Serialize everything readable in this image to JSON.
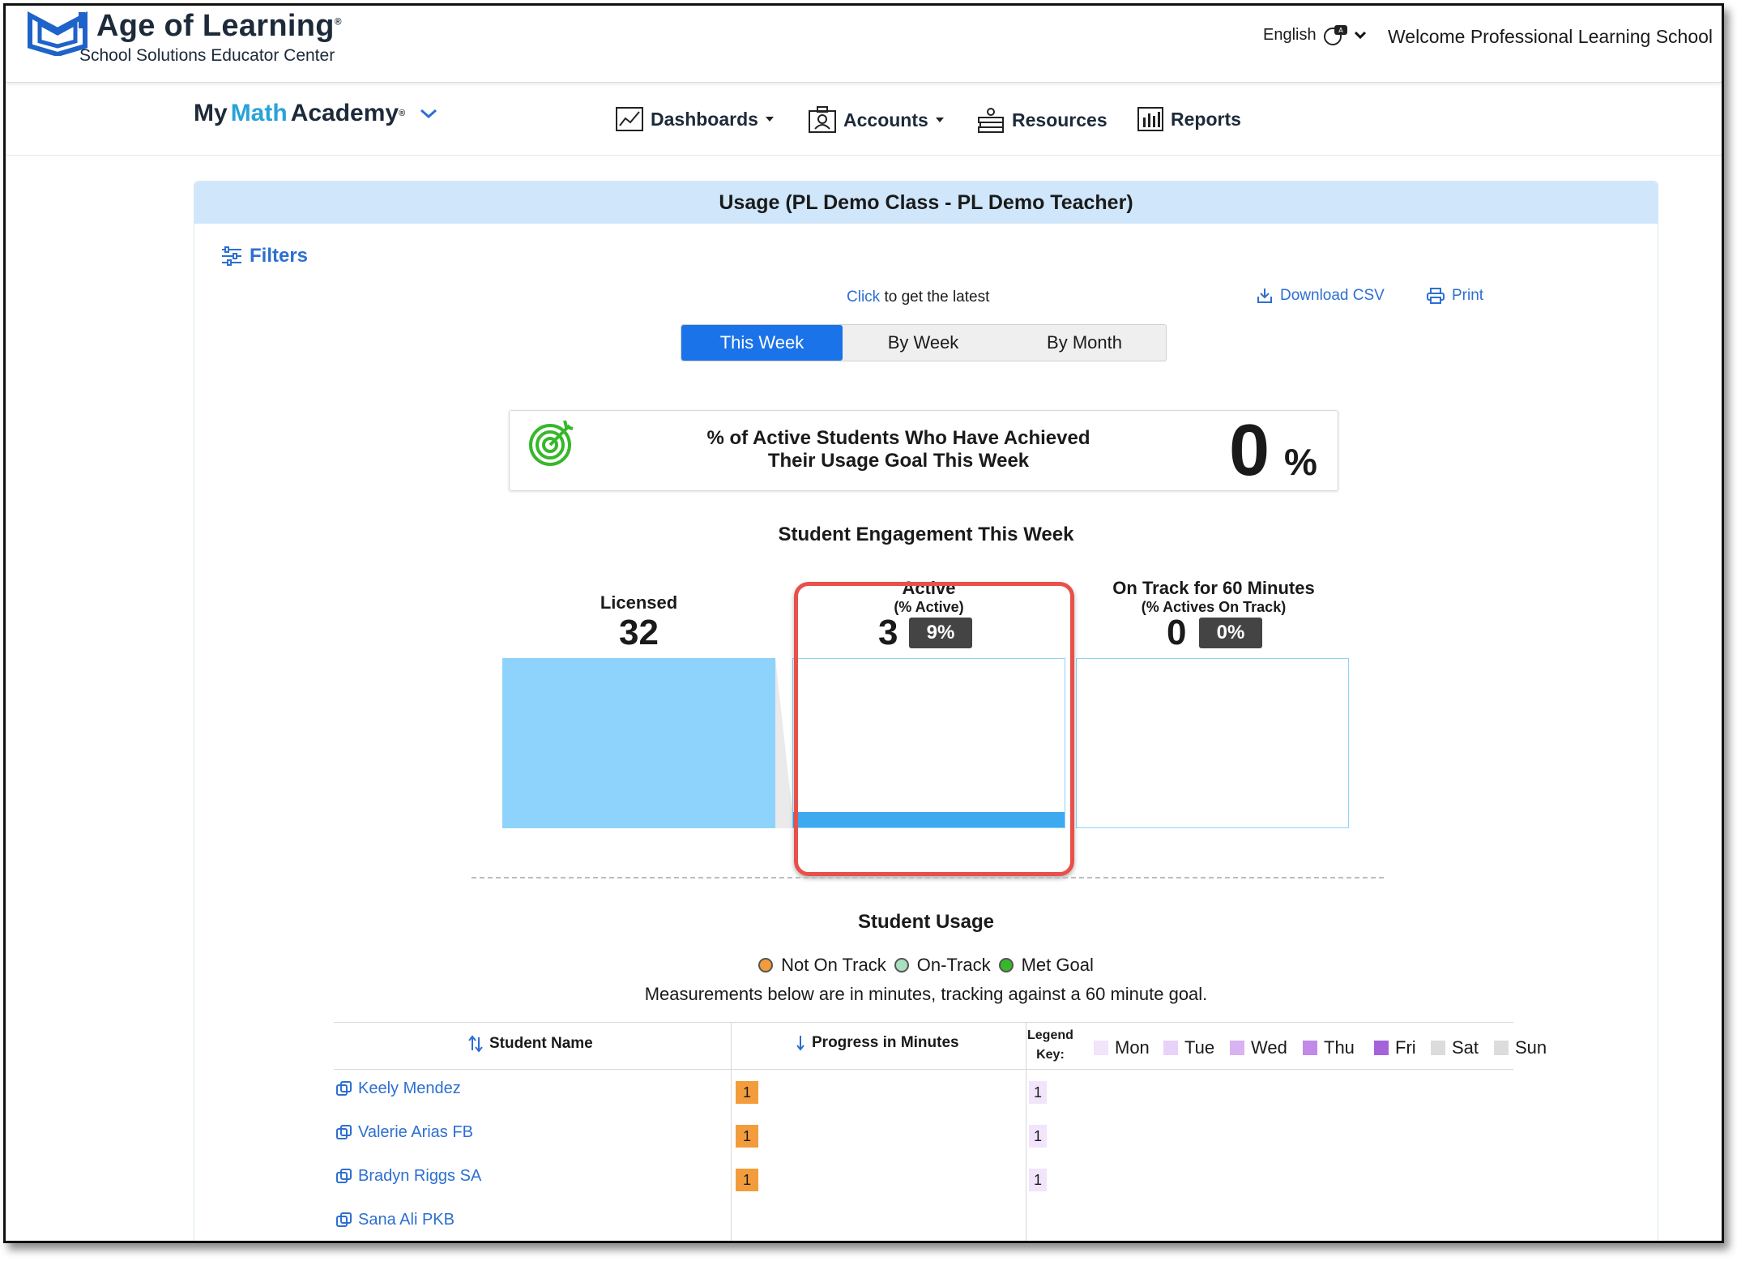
{
  "header": {
    "brand_title": "Age of Learning",
    "brand_registered": "®",
    "brand_subtitle": "School Solutions Educator Center",
    "language": "English",
    "welcome": "Welcome Professional Learning School"
  },
  "product": {
    "name_my": "My",
    "name_math": "Math",
    "name_academy": "Academy",
    "registered": "®"
  },
  "nav": {
    "dashboards": "Dashboards",
    "accounts": "Accounts",
    "resources": "Resources",
    "reports": "Reports"
  },
  "panel": {
    "title": "Usage (PL Demo Class - PL Demo Teacher)",
    "filters": "Filters",
    "refresh_link": "Click",
    "refresh_text": " to get the latest",
    "download": "Download CSV",
    "print": "Print",
    "tabs": [
      "This Week",
      "By Week",
      "By Month"
    ],
    "active_tab": "This Week"
  },
  "goal": {
    "line1": "% of Active Students Who Have Achieved",
    "line2": "Their Usage Goal This Week",
    "value": "0",
    "unit": "%"
  },
  "engagement": {
    "title": "Student Engagement This Week",
    "licensed_label": "Licensed",
    "licensed_value": "32",
    "active_label": "Active",
    "active_sub": "(% Active)",
    "active_value": "3",
    "active_pct": "9%",
    "active_fraction": 0.09,
    "ontrack_label": "On Track for 60 Minutes",
    "ontrack_sub": "(% Actives On Track)",
    "ontrack_value": "0",
    "ontrack_pct": "0%"
  },
  "usage": {
    "title": "Student Usage",
    "legend": [
      {
        "label": "Not On Track",
        "color": "#f39c3c"
      },
      {
        "label": "On-Track",
        "color": "#a8e0c0"
      },
      {
        "label": "Met Goal",
        "color": "#36b82a"
      }
    ],
    "measure_note": "Measurements below are in minutes, tracking against a 60 minute goal.",
    "col_student": "Student Name",
    "col_progress": "Progress in Minutes",
    "legend_key_1": "Legend",
    "legend_key_2": "Key:",
    "days": [
      {
        "label": "Mon",
        "color": "#f1e4fb"
      },
      {
        "label": "Tue",
        "color": "#e9d2f9"
      },
      {
        "label": "Wed",
        "color": "#d8b3f2"
      },
      {
        "label": "Thu",
        "color": "#c18ae8"
      },
      {
        "label": "Fri",
        "color": "#a463d9"
      },
      {
        "label": "Sat",
        "color": "#dcdcdc"
      },
      {
        "label": "Sun",
        "color": "#dcdcdc"
      }
    ],
    "rows": [
      {
        "name": "Keely Mendez",
        "progress": "1",
        "mon": "1"
      },
      {
        "name": "Valerie Arias FB",
        "progress": "1",
        "mon": "1"
      },
      {
        "name": "Bradyn Riggs SA",
        "progress": "1",
        "mon": "1"
      },
      {
        "name": "Sana Ali PKB",
        "progress": "",
        "mon": ""
      }
    ]
  },
  "colors": {
    "accent": "#1a73e8",
    "link": "#2d6fd1",
    "panel_header": "#cfe6fb",
    "bar": "#8ed3fb",
    "highlight": "#e8504a"
  }
}
